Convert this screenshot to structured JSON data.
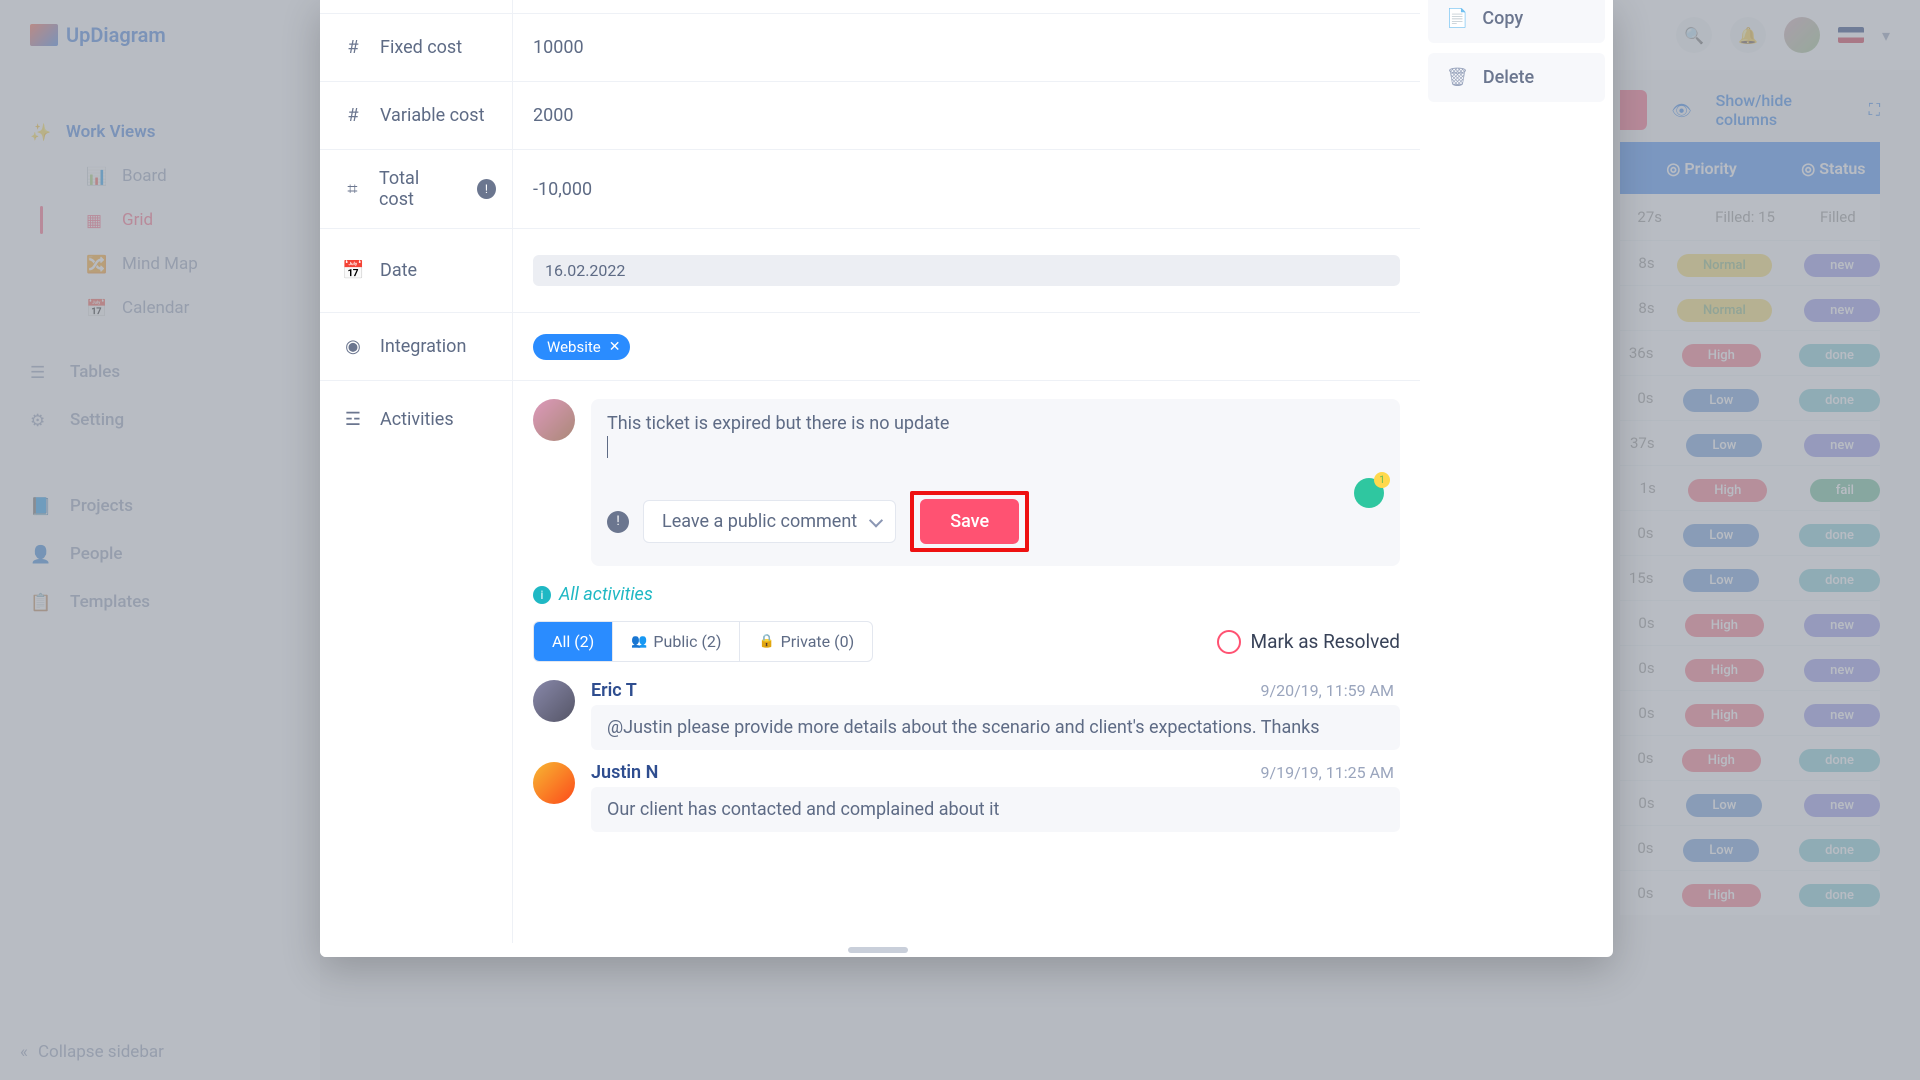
{
  "brand": "UpDiagram",
  "sidebar": {
    "work_views": "Work Views",
    "board": "Board",
    "grid": "Grid",
    "mindmap": "Mind Map",
    "calendar": "Calendar",
    "tables": "Tables",
    "setting": "Setting",
    "projects": "Projects",
    "people": "People",
    "templates": "Templates",
    "collapse": "Collapse sidebar"
  },
  "toolbar": {
    "show_hide": "Show/hide columns"
  },
  "grid": {
    "col_priority": "Priority",
    "col_status": "Status",
    "summary_left": "27s",
    "summary_filled": "Filled: 15",
    "summary_right": "Filled",
    "rows": [
      {
        "t": "8s",
        "p": "Normal",
        "pc": "norm",
        "s": "new",
        "sc": "new"
      },
      {
        "t": "8s",
        "p": "Normal",
        "pc": "norm",
        "s": "new",
        "sc": "new"
      },
      {
        "t": "36s",
        "p": "High",
        "pc": "high",
        "s": "done",
        "sc": "done"
      },
      {
        "t": "0s",
        "p": "Low",
        "pc": "low",
        "s": "done",
        "sc": "done"
      },
      {
        "t": "37s",
        "p": "Low",
        "pc": "low",
        "s": "new",
        "sc": "new"
      },
      {
        "t": "1s",
        "p": "High",
        "pc": "high",
        "s": "fail",
        "sc": "fail"
      },
      {
        "t": "0s",
        "p": "Low",
        "pc": "low",
        "s": "done",
        "sc": "done"
      },
      {
        "t": "15s",
        "p": "Low",
        "pc": "low",
        "s": "done",
        "sc": "done"
      },
      {
        "t": "0s",
        "p": "High",
        "pc": "high",
        "s": "new",
        "sc": "new"
      },
      {
        "t": "0s",
        "p": "High",
        "pc": "high",
        "s": "new",
        "sc": "new"
      },
      {
        "t": "0s",
        "p": "High",
        "pc": "high",
        "s": "new",
        "sc": "new"
      },
      {
        "t": "0s",
        "p": "High",
        "pc": "high",
        "s": "done",
        "sc": "done"
      },
      {
        "t": "0s",
        "p": "Low",
        "pc": "low",
        "s": "new",
        "sc": "new"
      },
      {
        "t": "0s",
        "p": "Low",
        "pc": "low",
        "s": "done",
        "sc": "done"
      },
      {
        "t": "0s",
        "p": "High",
        "pc": "high",
        "s": "done",
        "sc": "done"
      }
    ]
  },
  "modal": {
    "side_actions": {
      "copy": "Copy",
      "delete": "Delete"
    },
    "fields": {
      "fixed_cost_label": "Fixed cost",
      "fixed_cost_value": "10000",
      "variable_cost_label": "Variable cost",
      "variable_cost_value": "2000",
      "total_cost_label": "Total cost",
      "total_cost_value": "-10,000",
      "date_label": "Date",
      "date_value": "16.02.2022",
      "integration_label": "Integration",
      "integration_value": "Website",
      "activities_label": "Activities"
    },
    "comment_text": "This ticket is expired but there is no update",
    "leave_comment": "Leave a public comment",
    "save": "Save",
    "all_activities": "All activities",
    "tabs": {
      "all": "All (2)",
      "public": "Public (2)",
      "private": "Private (0)"
    },
    "resolve": "Mark as Resolved",
    "thread": [
      {
        "name": "Eric T",
        "time": "9/20/19, 11:59 AM",
        "text": "@Justin please provide more details about the scenario and client's expectations. Thanks"
      },
      {
        "name": "Justin N",
        "time": "9/19/19, 11:25 AM",
        "text": "Our client has contacted and complained about it"
      }
    ]
  }
}
